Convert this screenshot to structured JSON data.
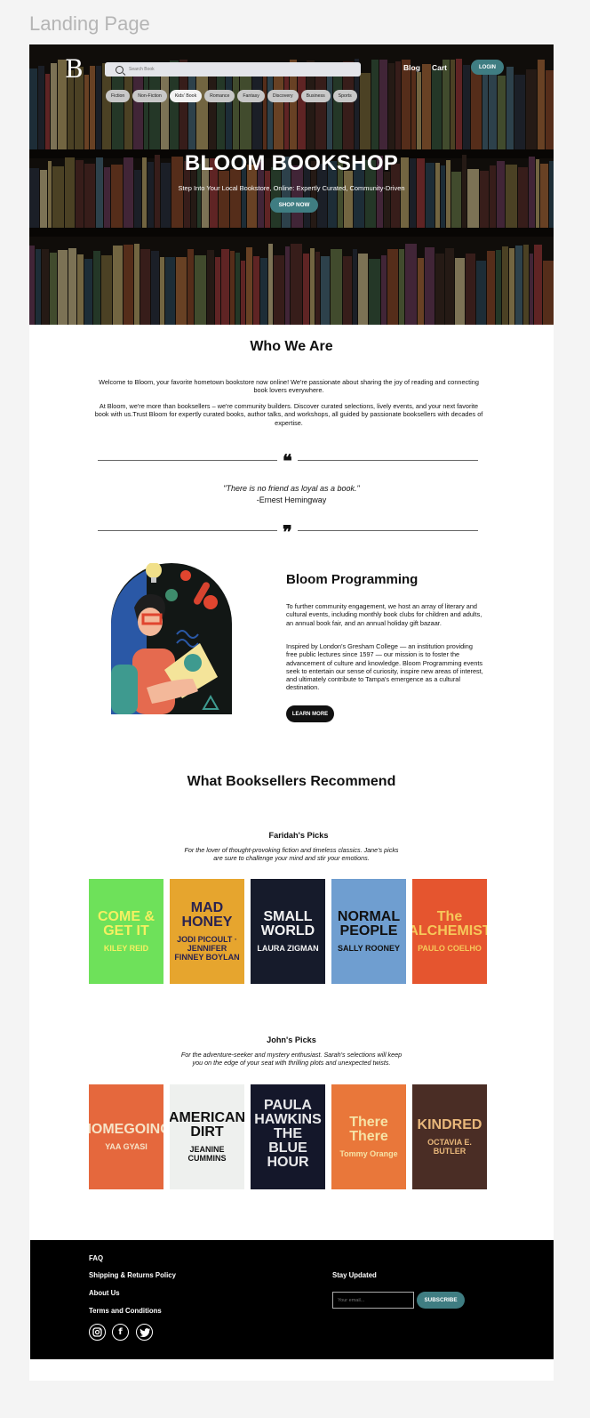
{
  "frame": {
    "title": "Landing Page"
  },
  "header": {
    "logo": "B",
    "search_placeholder": "Search Book",
    "nav": [
      "Blog",
      "Cart"
    ],
    "login_label": "LOGIN",
    "categories": [
      "Fiction",
      "Non-Fiction",
      "Kids' Book",
      "Romance",
      "Fantasy",
      "Discovery",
      "Business",
      "Sports"
    ],
    "active_category": "Kids' Book"
  },
  "hero": {
    "title": "BLOOM BOOKSHOP",
    "subtitle": "Step Into Your Local Bookstore, Online: Expertly Curated, Community-Driven",
    "cta": "SHOP NOW"
  },
  "about": {
    "heading": "Who We Are",
    "p1": "Welcome to Bloom, your favorite hometown bookstore now online! We're passionate about sharing the joy of reading and connecting book lovers everywhere.",
    "p2": "At Bloom, we're more than booksellers – we're community builders. Discover curated selections, lively events, and your next favorite book with us.Trust Bloom for expertly curated books, author talks, and workshops, all guided by passionate booksellers with decades of expertise.",
    "quote": "\"There is no friend as loyal as a book.\"",
    "quote_author": "-Ernest Hemingway"
  },
  "programming": {
    "heading": "Bloom Programming",
    "p1": "To further community engagement, we host an array of literary and cultural events, including monthly book clubs for children and adults, an annual book fair, and an annual holiday gift bazaar.",
    "p2": "Inspired by London's Gresham College — an institution providing free public lectures since 1597 — our mission is to foster the advancement of culture and knowledge. Bloom Programming events seek to entertain our sense of curiosity, inspire new areas of interest, and ultimately contribute to Tampa's emergence as a cultural destination.",
    "cta": "LEARN MORE"
  },
  "recommend": {
    "heading": "What Booksellers Recommend",
    "picks": [
      {
        "name": "Faridah's Picks",
        "desc1": "For the lover of thought-provoking fiction and timeless classics. Jane's picks",
        "desc2": "are sure to challenge your mind and stir your emotions.",
        "books": [
          {
            "title": "COME & GET IT",
            "author": "KILEY REID",
            "bg": "#6ee15a",
            "fg": "#f5f061"
          },
          {
            "title": "MAD HONEY",
            "author": "JODI PICOULT · JENNIFER FINNEY BOYLAN",
            "bg": "#e6a52e",
            "fg": "#2a2350"
          },
          {
            "title": "SMALL WORLD",
            "author": "LAURA ZIGMAN",
            "bg": "#161b2b",
            "fg": "#f2f2f2"
          },
          {
            "title": "NORMAL PEOPLE",
            "author": "SALLY ROONEY",
            "bg": "#6f9ed0",
            "fg": "#111"
          },
          {
            "title": "The ALCHEMIST",
            "author": "PAULO COELHO",
            "bg": "#e5552f",
            "fg": "#f6c85a"
          }
        ]
      },
      {
        "name": "John's Picks",
        "desc1": "For the adventure-seeker and mystery enthusiast. Sarah's selections will keep",
        "desc2": "you on the edge of your seat with thrilling plots and unexpected twists.",
        "books": [
          {
            "title": "HOMEGOING",
            "author": "YAA GYASI",
            "bg": "#e5683d",
            "fg": "#f6e4c8"
          },
          {
            "title": "AMERICAN DIRT",
            "author": "JEANINE CUMMINS",
            "bg": "#eef0ee",
            "fg": "#111"
          },
          {
            "title": "PAULA HAWKINS THE BLUE HOUR",
            "author": "",
            "bg": "#14172a",
            "fg": "#e8e8ea"
          },
          {
            "title": "There There",
            "author": "Tommy Orange",
            "bg": "#e9773a",
            "fg": "#f6e3a6"
          },
          {
            "title": "KINDRED",
            "author": "OCTAVIA E. BUTLER",
            "bg": "#4a2d25",
            "fg": "#e8b77a"
          }
        ]
      }
    ]
  },
  "footer": {
    "links": [
      "FAQ",
      "Shipping & Returns Policy",
      "About Us",
      "Terms and Conditions"
    ],
    "social": [
      "instagram-icon",
      "facebook-icon",
      "twitter-icon"
    ],
    "newsletter_heading": "Stay Updated",
    "email_placeholder": "Your email...",
    "subscribe_label": "SUBSCRIBE"
  }
}
